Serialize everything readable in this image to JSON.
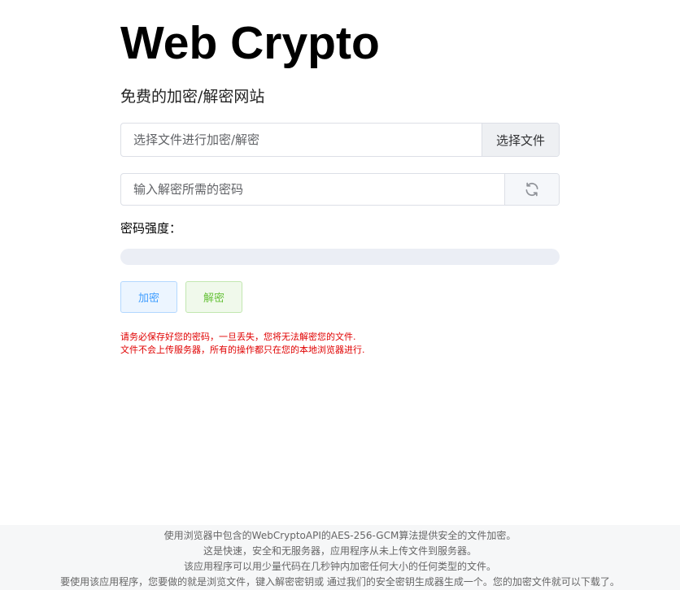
{
  "header": {
    "title": "Web Crypto",
    "subtitle": "免费的加密/解密网站"
  },
  "file_input": {
    "placeholder": "选择文件进行加密/解密",
    "button_label": "选择文件"
  },
  "password_input": {
    "placeholder": "输入解密所需的密码",
    "refresh_icon": "refresh-icon"
  },
  "strength": {
    "label": "密码强度：",
    "value": 0
  },
  "actions": {
    "encrypt_label": "加密",
    "decrypt_label": "解密"
  },
  "warnings": [
    "请务必保存好您的密码，一旦丢失，您将无法解密您的文件.",
    "文件不会上传服务器，所有的操作都只在您的本地浏览器进行."
  ],
  "footer": {
    "lines": [
      "使用浏览器中包含的WebCryptoAPI的AES-256-GCM算法提供安全的文件加密。",
      "这是快速，安全和无服务器，应用程序从未上传文件到服务器。",
      "该应用程序可以用少量代码在几秒钟内加密任何大小的任何类型的文件。",
      "要使用该应用程序，您要做的就是浏览文件，键入解密密钥或 通过我们的安全密钥生成器生成一个。您的加密文件就可以下载了。"
    ]
  },
  "colors": {
    "encrypt_accent": "#409eff",
    "decrypt_accent": "#67c23a",
    "warning": "#e00000",
    "progress_track": "#ebeef5"
  }
}
